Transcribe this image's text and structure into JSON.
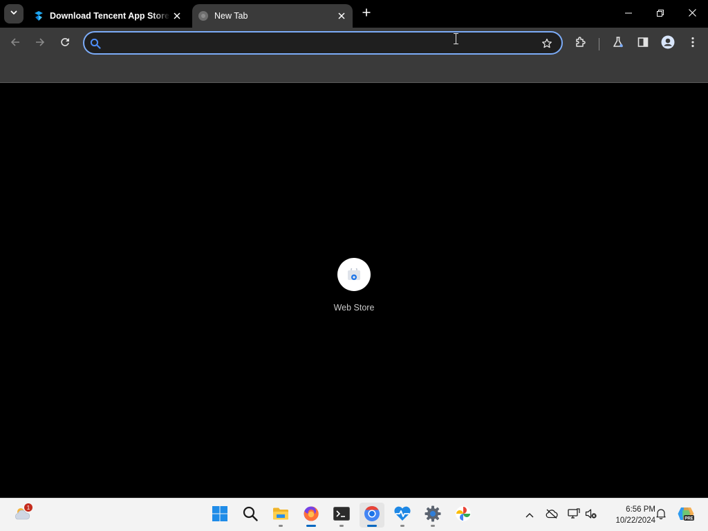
{
  "browser": {
    "tabs": [
      {
        "title": "Download Tencent App Store (",
        "active": false
      },
      {
        "title": "New Tab",
        "active": true
      }
    ],
    "omnibox": {
      "value": "",
      "placeholder": ""
    },
    "accent_color": "#7cacf8"
  },
  "new_tab": {
    "shortcuts": [
      {
        "label": "Web Store",
        "icon": "chrome-web-store-icon"
      }
    ]
  },
  "taskbar": {
    "weather_badge": "1",
    "apps": [
      "start",
      "search",
      "file-explorer",
      "firefox",
      "terminal",
      "chrome",
      "health-app",
      "settings",
      "photos-app"
    ],
    "clock": {
      "time": "6:56 PM",
      "date": "10/22/2024"
    }
  }
}
